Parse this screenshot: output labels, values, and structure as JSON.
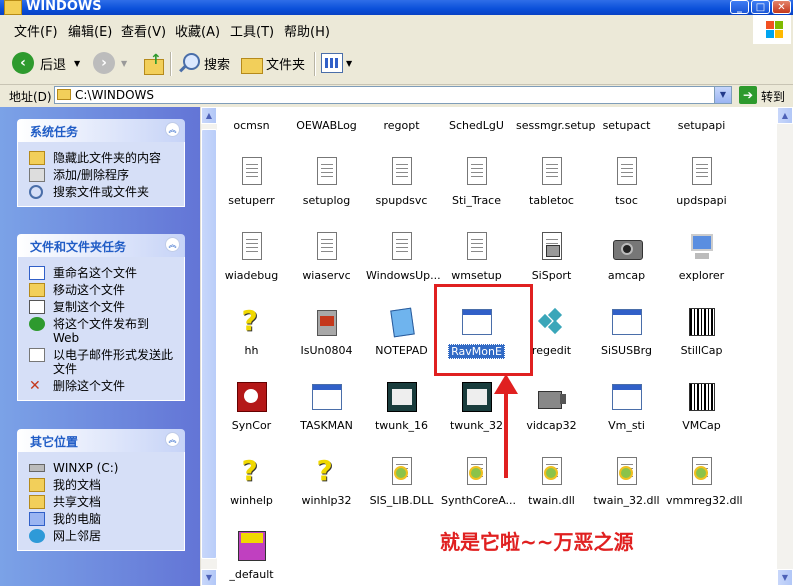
{
  "window": {
    "title": "WINDOWS",
    "min": "_",
    "max": "□",
    "close": "✕"
  },
  "menu": [
    "文件(F)",
    "编辑(E)",
    "查看(V)",
    "收藏(A)",
    "工具(T)",
    "帮助(H)"
  ],
  "toolbar": {
    "back": "后退",
    "search": "搜索",
    "folders": "文件夹"
  },
  "address": {
    "label": "地址(D)",
    "value": "C:\\WINDOWS",
    "go": "转到"
  },
  "left_panes": [
    {
      "title": "系统任务",
      "items": [
        {
          "label": "隐藏此文件夹的内容",
          "icon": "hide-folder-icon"
        },
        {
          "label": "添加/删除程序",
          "icon": "add-remove-icon"
        },
        {
          "label": "搜索文件或文件夹",
          "icon": "search-icon"
        }
      ]
    },
    {
      "title": "文件和文件夹任务",
      "items": [
        {
          "label": "重命名这个文件",
          "icon": "rename-icon"
        },
        {
          "label": "移动这个文件",
          "icon": "move-icon"
        },
        {
          "label": "复制这个文件",
          "icon": "copy-icon"
        },
        {
          "label": "将这个文件发布到 Web",
          "icon": "publish-web-icon"
        },
        {
          "label": "以电子邮件形式发送此文件",
          "icon": "email-icon"
        },
        {
          "label": "删除这个文件",
          "icon": "delete-icon"
        }
      ]
    },
    {
      "title": "其它位置",
      "items": [
        {
          "label": "WINXP (C:)",
          "icon": "drive-icon"
        },
        {
          "label": "我的文档",
          "icon": "my-documents-icon"
        },
        {
          "label": "共享文档",
          "icon": "shared-documents-icon"
        },
        {
          "label": "我的电脑",
          "icon": "my-computer-icon"
        },
        {
          "label": "网上邻居",
          "icon": "network-icon"
        }
      ]
    }
  ],
  "files": [
    [
      "ocmsn",
      "OEWABLog",
      "regopt",
      "SchedLgU",
      "sessmgr.setup",
      "setupact",
      "setupapi"
    ],
    [
      "setuperr",
      "setuplog",
      "spupdsvc",
      "Sti_Trace",
      "tabletoc",
      "tsoc",
      "updspapi"
    ],
    [
      "wiadebug",
      "wiaservc",
      "WindowsUp...",
      "wmsetup",
      "SiSport",
      "amcap",
      "explorer"
    ],
    [
      "hh",
      "IsUn0804",
      "NOTEPAD",
      "RavMonE",
      "regedit",
      "SiSUSBrg",
      "StillCap"
    ],
    [
      "SynCor",
      "TASKMAN",
      "twunk_16",
      "twunk_32",
      "vidcap32",
      "Vm_sti",
      "VMCap"
    ],
    [
      "winhelp",
      "winhlp32",
      "SIS_LIB.DLL",
      "SynthCoreA...",
      "twain.dll",
      "twain_32.dll",
      "vmmreg32.dll"
    ],
    [
      "_default"
    ]
  ],
  "annotation": "就是它啦~~万恶之源",
  "colors": {
    "accent": "#e02020",
    "title_bar": "#0a4fd9",
    "selection": "#316ac5"
  }
}
